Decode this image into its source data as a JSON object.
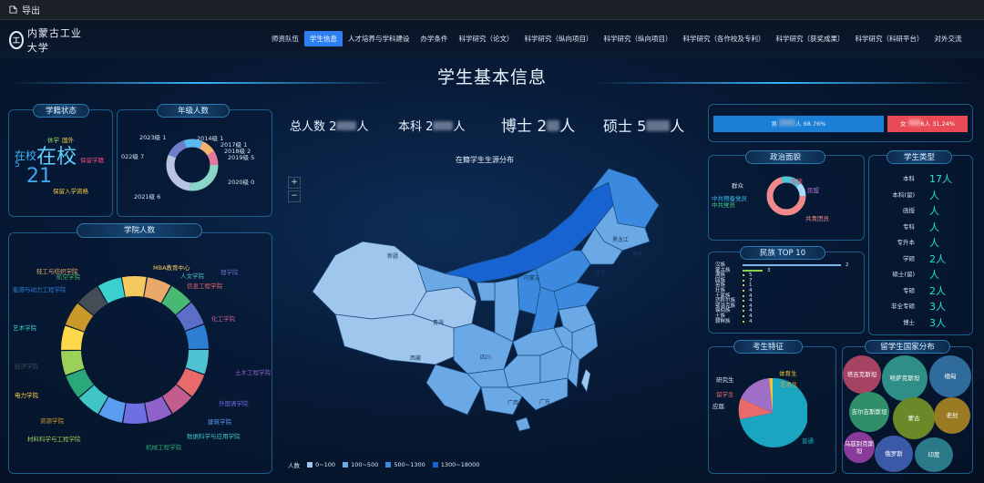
{
  "topbar": {
    "export_label": "导出"
  },
  "header": {
    "logo_text": "内蒙古工业大学",
    "nav": [
      "师资队伍",
      "学生信息",
      "人才培养与学科建设",
      "办学条件",
      "科学研究（论文）",
      "科学研究（纵向项目）",
      "科学研究（纵向项目）",
      "科学研究（各作校及专利）",
      "科学研究（获奖成果）",
      "科学研究（科研平台）",
      "对外交流"
    ],
    "active_index": 1
  },
  "page_title": "学生基本信息",
  "status_panel": {
    "title": "学籍状态",
    "big_label": "在校",
    "small_label": "在校",
    "small_num": "5",
    "big_num": "21",
    "tags": [
      "休学",
      "国外",
      "保留学籍",
      "保留入学资格"
    ]
  },
  "grade_panel": {
    "title": "年级人数",
    "labels": [
      "2023级 1",
      "2014级 1",
      "2017级 1",
      "2018级 2",
      "2019级 5",
      "2020级 0",
      "2021级 6",
      "022级 7"
    ],
    "unit": "人"
  },
  "summary": {
    "total_label": "总人数",
    "total_num": "2",
    "undergrad_label": "本科",
    "undergrad_num": "2",
    "phd_label": "博士",
    "phd_num": "2",
    "master_label": "硕士",
    "master_num": "5",
    "unit": "人"
  },
  "map": {
    "title": "在籍学生生源分布",
    "zoom_in": "+",
    "zoom_out": "−",
    "legend_label": "人数",
    "legend": [
      {
        "label": "0~100",
        "color": "#9fc6ec"
      },
      {
        "label": "100~500",
        "color": "#6aa8e6"
      },
      {
        "label": "500~1300",
        "color": "#3b8ae0"
      },
      {
        "label": "1300~18000",
        "color": "#1663d1"
      }
    ],
    "provinces": [
      "新疆",
      "西藏",
      "内蒙古",
      "黑龙江",
      "吉林",
      "辽宁",
      "青海",
      "四川",
      "广西",
      "广东"
    ]
  },
  "college_panel": {
    "title": "学院人数",
    "labels": [
      "MBA教育中心",
      "轻工与纺织学院",
      "航空学院",
      "理学院",
      "能源与动力工程学院",
      "人文学院",
      "信息工程学院",
      "化工学院",
      "土木工程学院",
      "外国语学院",
      "建筑学院",
      "数据科学与应用学院",
      "机械工程学院",
      "材料科学与工程学院",
      "电力学院",
      "资源学院",
      "经济学院",
      "艺术学院"
    ],
    "unit": "人"
  },
  "gender": {
    "male_label": "男",
    "male_pct": "人 68.76%",
    "female_label": "女",
    "female_pct": "6人 31.24%"
  },
  "politics": {
    "title": "政治面貌",
    "labels": [
      "群众",
      "民建",
      "民盟",
      "中共预备党员",
      "中共党员",
      "共青团员"
    ]
  },
  "student_type": {
    "title": "学生类型",
    "rows": [
      {
        "label": "本科",
        "value": "17人"
      },
      {
        "label": "本科(留)",
        "value": "人"
      },
      {
        "label": "函授",
        "value": "人"
      },
      {
        "label": "专科",
        "value": "人"
      },
      {
        "label": "专升本",
        "value": "人"
      },
      {
        "label": "学硕",
        "value": "2人"
      },
      {
        "label": "硕士(留)",
        "value": "人"
      },
      {
        "label": "专硕",
        "value": "2人"
      },
      {
        "label": "非全专硕",
        "value": "3人"
      },
      {
        "label": "博士",
        "value": "3人"
      }
    ]
  },
  "ethnic": {
    "title": "民族 TOP 10",
    "names": [
      "汉族",
      "蒙古族",
      "满族",
      "回族",
      "苗族",
      "壮族",
      "土家族",
      "达斡尔族",
      "鄂温克族",
      "锡伯族",
      "土族",
      "朝鲜族"
    ],
    "values": [
      "2",
      "3",
      "5",
      "7",
      "1",
      "4",
      "4",
      "4",
      "4",
      "4",
      "4",
      "4"
    ]
  },
  "features": {
    "title": "考生特征",
    "labels": [
      "研究生",
      "留学生",
      "应届",
      "普通",
      "体育生",
      "艺术生"
    ]
  },
  "intl": {
    "title": "留学生国家分布",
    "countries": [
      "塔吉克斯坦",
      "哈萨克斯坦",
      "缅甸",
      "吉尔吉斯斯坦",
      "蒙古",
      "老挝",
      "乌兹别克斯坦",
      "俄罗斯",
      "印度"
    ]
  }
}
